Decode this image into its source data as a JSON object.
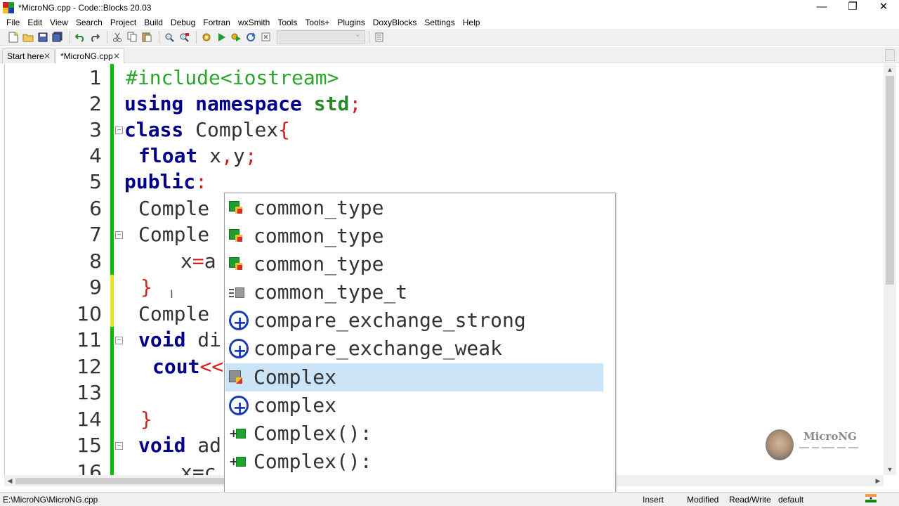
{
  "window": {
    "title": "*MicroNG.cpp - Code::Blocks 20.03",
    "minimize_glyph": "—",
    "restore_glyph": "❐",
    "close_glyph": "✕"
  },
  "menu": [
    "File",
    "Edit",
    "View",
    "Search",
    "Project",
    "Build",
    "Debug",
    "Fortran",
    "wxSmith",
    "Tools",
    "Tools+",
    "Plugins",
    "DoxyBlocks",
    "Settings",
    "Help"
  ],
  "toolbar": {
    "icons": [
      "new-file-icon",
      "open-file-icon",
      "save-icon",
      "save-all-icon",
      "undo-icon",
      "redo-icon",
      "cut-icon",
      "copy-icon",
      "paste-icon",
      "find-icon",
      "replace-icon",
      "build-icon",
      "run-icon",
      "build-and-run-icon",
      "rebuild-icon",
      "abort-icon",
      "build-target-combo",
      "target-options-icon"
    ]
  },
  "tabs": [
    {
      "label": "Start here",
      "close": "✕"
    },
    {
      "label": "*MicroNG.cpp",
      "close": "✕"
    }
  ],
  "editor": {
    "line_numbers": [
      "1",
      "2",
      "3",
      "4",
      "5",
      "6",
      "7",
      "8",
      "9",
      "10",
      "11",
      "12",
      "13",
      "14",
      "15",
      "16"
    ],
    "lines": {
      "l1": "#include<iostream>",
      "l2_kw1": "using",
      "l2_kw2": "namespace",
      "l2_kw3": "std",
      "l2_semi": ";",
      "l3_kw": "class",
      "l3_name": " Complex",
      "l3_brace": "{",
      "l4_kw": "float",
      "l4_x": " x",
      "l4_comma": ",",
      "l4_y": "y",
      "l4_semi": ";",
      "l5_kw": "public",
      "l5_colon": ":",
      "l6": "Comple",
      "l7": "Comple",
      "l8_x": "x",
      "l8_eq": "=",
      "l8_a": "a",
      "l9_brace": "}",
      "l10": "Comple",
      "l11_kw": "void",
      "l11_rest": " di",
      "l12_kw": "cout",
      "l12_op": "<<",
      "l13": "",
      "l14_brace": "}",
      "l15_kw": "void",
      "l15_rest": " ad",
      "l16": "x=c"
    }
  },
  "autocomplete": {
    "items": [
      {
        "label": "common_type",
        "icon": "type-icon"
      },
      {
        "label": "common_type",
        "icon": "type-icon"
      },
      {
        "label": "common_type",
        "icon": "type-icon"
      },
      {
        "label": "common_type_t",
        "icon": "typedef-icon"
      },
      {
        "label": "compare_exchange_strong",
        "icon": "cpp-function-icon"
      },
      {
        "label": "compare_exchange_weak",
        "icon": "cpp-function-icon"
      },
      {
        "label": "Complex",
        "icon": "class-icon",
        "selected": true
      },
      {
        "label": "complex",
        "icon": "cpp-function-icon"
      },
      {
        "label": "Complex():",
        "icon": "constructor-icon"
      },
      {
        "label": "Complex():",
        "icon": "constructor-icon"
      }
    ]
  },
  "watermark": {
    "brand": "MicroNG"
  },
  "statusbar": {
    "path": "E:\\MicroNG\\MicroNG.cpp",
    "insert": "Insert",
    "modified": "Modified",
    "readwrite": "Read/Write",
    "highlighter": "default"
  },
  "colors": {
    "keyword": "#00008b",
    "preprocessor": "#2aa52a",
    "operator": "#d42020",
    "change_bar": "#00c000",
    "selection": "#cce4f7"
  }
}
